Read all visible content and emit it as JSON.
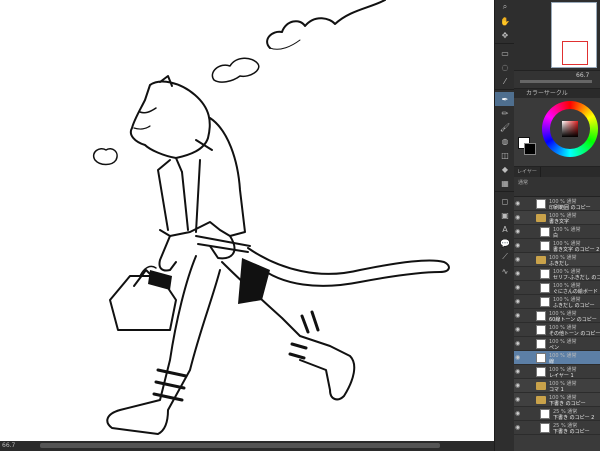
{
  "status": {
    "zoom": "66.7"
  },
  "navigator": {
    "zoom_value": "66.7"
  },
  "color_panel": {
    "title": "カラーサークル",
    "fg": "#ffffff",
    "bg": "#000000"
  },
  "layer_panel": {
    "tabs": [
      "レイヤー",
      "",
      ""
    ],
    "blend_mode": "通常",
    "layers": [
      {
        "mode": "100 % 通常",
        "name": "印刷範囲 のコピー",
        "type": "layer",
        "indent": 0,
        "selected": false
      },
      {
        "mode": "100 % 通常",
        "name": "書き文字",
        "type": "folder",
        "indent": 0,
        "selected": false
      },
      {
        "mode": "100 % 通常",
        "name": "白",
        "type": "layer",
        "indent": 1,
        "selected": false
      },
      {
        "mode": "100 % 通常",
        "name": "書き文字 のコピー 2",
        "type": "layer",
        "indent": 1,
        "selected": false
      },
      {
        "mode": "100 % 通常",
        "name": "ふきだし",
        "type": "folder",
        "indent": 0,
        "selected": false
      },
      {
        "mode": "100 % 通常",
        "name": "セリフ-ふきだし のコピー",
        "type": "layer",
        "indent": 1,
        "selected": false
      },
      {
        "mode": "100 % 通常",
        "name": "ぐにさんの絵ボード",
        "type": "layer",
        "indent": 1,
        "selected": false
      },
      {
        "mode": "100 % 通常",
        "name": "ふきだし のコピー",
        "type": "layer",
        "indent": 1,
        "selected": false
      },
      {
        "mode": "100 % 通常",
        "name": "60線トーン のコピー",
        "type": "layer",
        "indent": 0,
        "selected": false
      },
      {
        "mode": "100 % 通常",
        "name": "その他トーン のコピー",
        "type": "layer",
        "indent": 0,
        "selected": false
      },
      {
        "mode": "100 % 通常",
        "name": "ペン",
        "type": "layer",
        "indent": 0,
        "selected": false
      },
      {
        "mode": "100 % 通常",
        "name": "線",
        "type": "layer",
        "indent": 0,
        "selected": true
      },
      {
        "mode": "100 % 通常",
        "name": "レイヤー 1",
        "type": "layer",
        "indent": 0,
        "selected": false
      },
      {
        "mode": "100 % 通常",
        "name": "コマ 1",
        "type": "folder",
        "indent": 0,
        "selected": false
      },
      {
        "mode": "100 % 通常",
        "name": "下書き のコピー",
        "type": "folder",
        "indent": 0,
        "selected": false
      },
      {
        "mode": "25 % 通常",
        "name": "下書き のコピー 2",
        "type": "layer",
        "indent": 1,
        "selected": false
      },
      {
        "mode": "25 % 通常",
        "name": "下書き のコピー",
        "type": "layer",
        "indent": 1,
        "selected": false
      }
    ]
  },
  "tools": [
    "zoom-icon",
    "hand-icon",
    "move-icon",
    "select-icon",
    "lasso-icon",
    "eyedropper-icon",
    "pen-icon",
    "pencil-icon",
    "brush-icon",
    "airbrush-icon",
    "eraser-icon",
    "fill-icon",
    "gradient-icon",
    "shape-icon",
    "frame-icon",
    "text-icon",
    "balloon-icon",
    "ruler-icon",
    "correct-line-icon"
  ]
}
